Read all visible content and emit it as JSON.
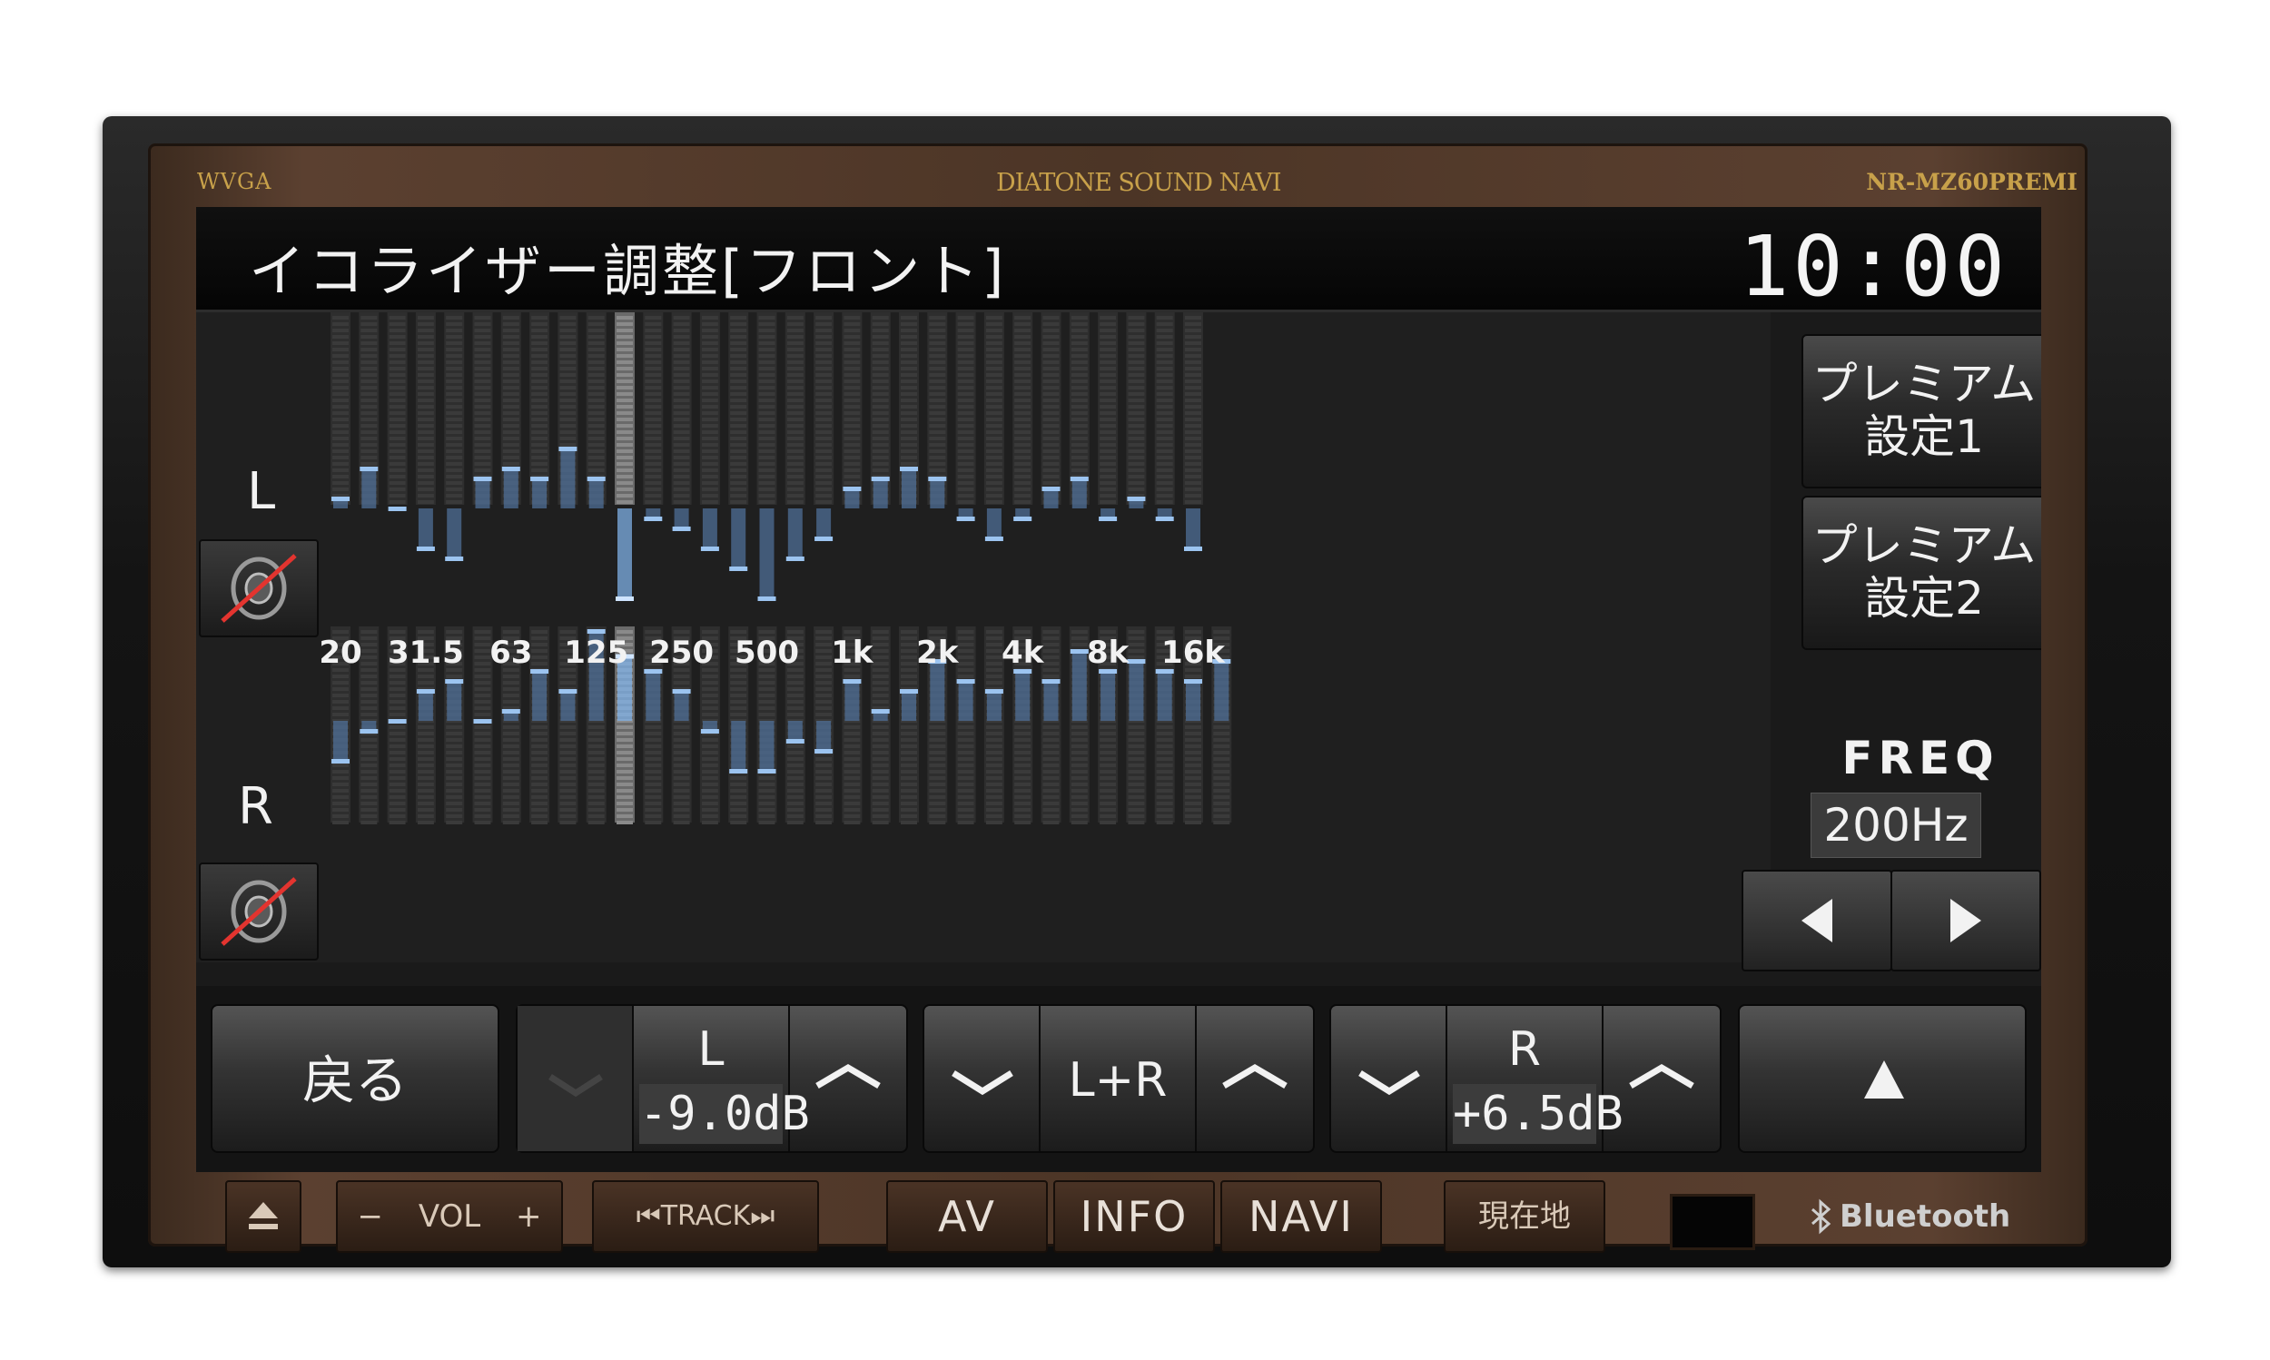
{
  "device": {
    "badge_left": "WVGA",
    "brand": "DIATONE SOUND NAVI",
    "model": "NR-MZ60PREMI"
  },
  "header": {
    "title": "イコライザー調整[フロント]",
    "clock": "10:00"
  },
  "equalizer": {
    "channels": [
      {
        "label": "L",
        "mute_icon": "speaker-mute-icon"
      },
      {
        "label": "R",
        "mute_icon": "speaker-mute-icon"
      }
    ],
    "freq_labels": [
      "20",
      "31.5",
      "63",
      "125",
      "250",
      "500",
      "1k",
      "2k",
      "4k",
      "8k",
      "16k"
    ],
    "selected_band_index": 10,
    "band_levels_L": [
      1,
      4,
      0,
      -4,
      -5,
      3,
      4,
      3,
      6,
      3,
      -9,
      -1,
      -2,
      -4,
      -6,
      -9,
      -5,
      -3,
      2,
      3,
      4,
      3,
      -1,
      -3,
      -1,
      2,
      3,
      -1,
      1,
      -1,
      -4
    ],
    "band_levels_R": [
      -4,
      -1,
      0,
      3,
      4,
      0,
      1,
      5,
      3,
      9,
      6.5,
      5,
      3,
      -1,
      -5,
      -5,
      -2,
      -3,
      4,
      1,
      3,
      6,
      4,
      3,
      5,
      4,
      7,
      5,
      6,
      5,
      4,
      6
    ]
  },
  "right_panel": {
    "preset1": [
      "プレミアム",
      "設定1"
    ],
    "preset2": [
      "プレミアム",
      "設定2"
    ],
    "freq_title": "FREQ",
    "freq_value": "200Hz",
    "prev_icon": "triangle-left-icon",
    "next_icon": "triangle-right-icon"
  },
  "bottom": {
    "back_label": "戻る",
    "left_group": {
      "label": "L",
      "value": "-9.0dB"
    },
    "center_group": {
      "label": "L+R"
    },
    "right_group": {
      "label": "R",
      "value": "+6.5dB"
    },
    "up_icon": "triangle-up-icon"
  },
  "hardware_buttons": {
    "eject_icon": "eject-icon",
    "vol_minus": "−",
    "vol_label": "VOL",
    "vol_plus": "+",
    "track_label": "⏮TRACK⏭",
    "av": "AV",
    "info": "INFO",
    "navi": "NAVI",
    "current_location": "現在地",
    "bluetooth": "Bluetooth"
  }
}
